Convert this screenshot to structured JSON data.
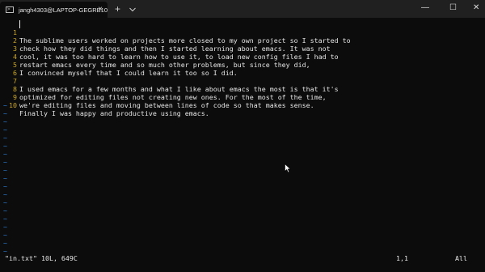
{
  "window": {
    "tab_title": "jangh4303@LAPTOP-GEGRB10",
    "close_tab": "×",
    "new_tab": "+",
    "minimize": "—",
    "maximize": "☐",
    "close": "✕",
    "icons": [
      "terminal-icon",
      "chevron-down-icon"
    ]
  },
  "editor": {
    "lines": [
      {
        "num": "1",
        "text": "The sublime users worked on projects more closed to my own project so I started to"
      },
      {
        "num": "2",
        "text": "check how they did things and then I started learning about emacs. It was not"
      },
      {
        "num": "3",
        "text": "cool, it was too hard to learn how to use it, to load new config files I had to"
      },
      {
        "num": "4",
        "text": "restart emacs every time and so much other problems, but since they did,"
      },
      {
        "num": "5",
        "text": "I convinced myself that I could learn it too so I did."
      },
      {
        "num": "6",
        "text": ""
      },
      {
        "num": "7",
        "text": "I used emacs for a few months and what I like about emacs the most is that it's"
      },
      {
        "num": "8",
        "text": "optimized for editing files not creating new ones. For the most of the time,"
      },
      {
        "num": "9",
        "text": "we're editing files and moving between lines of code so that makes sense."
      },
      {
        "num": "10",
        "text": "Finally I was happy and productive using emacs."
      }
    ],
    "empty_marker": "~",
    "empty_line_count": 19,
    "colors": {
      "line_number": "#c8a52a",
      "tilde": "#2f7dd6",
      "text": "#e6e6e6",
      "background": "#0c0c0c"
    }
  },
  "status": {
    "file": "\"in.txt\" 10L, 649C",
    "position": "1,1",
    "scroll": "All"
  }
}
